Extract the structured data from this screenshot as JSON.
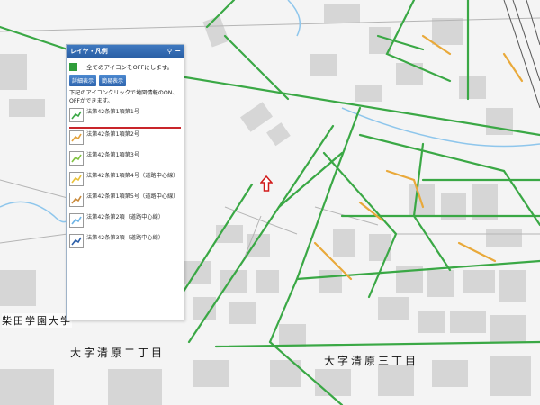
{
  "legend": {
    "title": "レイヤ・凡例",
    "pin_icon": "pin-icon",
    "minimize_icon": "minimize-icon",
    "all_off_label": "全てのアイコンをOFFにします。",
    "detail_button": "詳細表示",
    "simple_button": "簡易表示",
    "instruction": "下記のアイコンクリックで地図情報のON、OFFができます。",
    "items": [
      {
        "label": "法第42条第1項第1号",
        "color": "#3aa845"
      },
      {
        "label": "法第42条第1項第2号",
        "color": "#e3a13a"
      },
      {
        "label": "法第42条第1項第3号",
        "color": "#7fc23f"
      },
      {
        "label": "法第42条第1項第4号（道路中心線）",
        "color": "#e9c13a"
      },
      {
        "label": "法第42条第1項第5号（道路中心線）",
        "color": "#c98a3c"
      },
      {
        "label": "法第42条第2項（道路中心線）",
        "color": "#6db4e6"
      },
      {
        "label": "法第42条第3項（道路中心線）",
        "color": "#2c5fa8"
      }
    ]
  },
  "map": {
    "labels": {
      "shibata": "柴田学園大学",
      "chome2": "大字清原二丁目",
      "chome3": "大字清原三丁目"
    },
    "marker_icon": "location-arrow-icon",
    "road_colors": {
      "road_green": "#3aa845",
      "road_orange": "#e9a93a",
      "road_blue": "#6db4e6"
    }
  }
}
